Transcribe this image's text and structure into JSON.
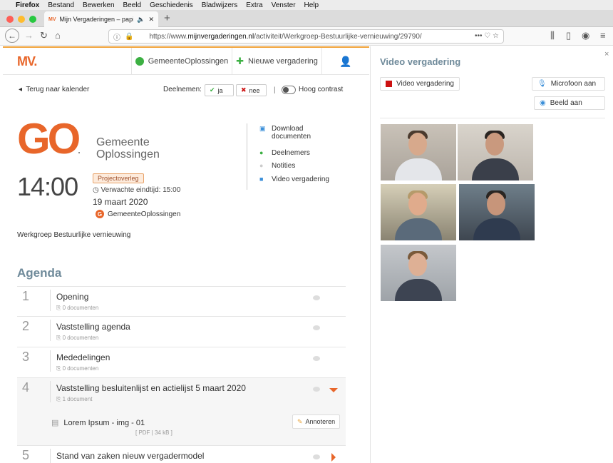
{
  "mac_menubar": {
    "apple": "",
    "app": "Firefox",
    "items": [
      "Bestand",
      "Bewerken",
      "Beeld",
      "Geschiedenis",
      "Bladwijzers",
      "Extra",
      "Venster",
      "Help"
    ]
  },
  "browser": {
    "tab_title": "Mijn Vergaderingen – papier",
    "tab_favicon": "MV",
    "new_tab": "+",
    "url_prefix": "https://www.",
    "url_domain": "mijnvergaderingen.nl",
    "url_path": "/activiteit/Werkgroep-Bestuurlijke-vernieuwing/29790/",
    "url_actions": "•••"
  },
  "header": {
    "logo": "MV.",
    "org": "GemeenteOplossingen",
    "new_meeting": "Nieuwe vergadering",
    "plus_icon": "✚",
    "user_icon": "user-icon"
  },
  "toolbar": {
    "back": "Terug naar kalender",
    "deelnemen": "Deelnemen:",
    "ja": "ja",
    "nee": "nee",
    "sep": "|",
    "high_contrast": "Hoog contrast"
  },
  "meeting": {
    "logo_text": "GO",
    "logo_dot": ".",
    "org_line1": "Gemeente",
    "org_line2": "Oplossingen",
    "time": "14:00",
    "type": "Projectoverleg",
    "end_time": "Verwachte eindtijd: 15:00",
    "date": "19 maart 2020",
    "org_badge": "G",
    "org_name": "GemeenteOplossingen",
    "group": "Werkgroep Bestuurlijke vernieuwing"
  },
  "actions": [
    {
      "icon": "💾",
      "label1": "Download",
      "label2": "documenten"
    },
    {
      "icon": "👥",
      "label1": "Deelnemers"
    },
    {
      "icon": "💬",
      "label1": "Notities"
    },
    {
      "icon": "🎥",
      "label1": "Video vergadering"
    }
  ],
  "agenda": {
    "title": "Agenda",
    "items": [
      {
        "num": "1",
        "title": "Opening",
        "docs": "⎘ 0 documenten"
      },
      {
        "num": "2",
        "title": "Vaststelling agenda",
        "docs": "⎘ 0 documenten"
      },
      {
        "num": "3",
        "title": "Mededelingen",
        "docs": "⎘ 0 documenten"
      },
      {
        "num": "4",
        "title": "Vaststelling besluitenlijst en actielijst 5 maart 2020",
        "docs": "⎘ 1 document"
      },
      {
        "num": "5",
        "title": "Stand van zaken nieuw vergadermodel",
        "docs": ""
      }
    ],
    "document": {
      "name": "Lorem Ipsum - img - 01",
      "meta": "[ PDF | 34 kB ]",
      "annotate": "Annoteren"
    }
  },
  "video": {
    "title": "Video vergadering",
    "close": "×",
    "btn_video": "Video vergadering",
    "btn_mic": "Microfoon aan",
    "btn_cam": "Beeld aan"
  },
  "colors": {
    "accent": "#e8662a",
    "green": "#3cb043",
    "heading": "#6f8a9a",
    "record": "#cc1111",
    "mic": "#3b8fd9"
  }
}
